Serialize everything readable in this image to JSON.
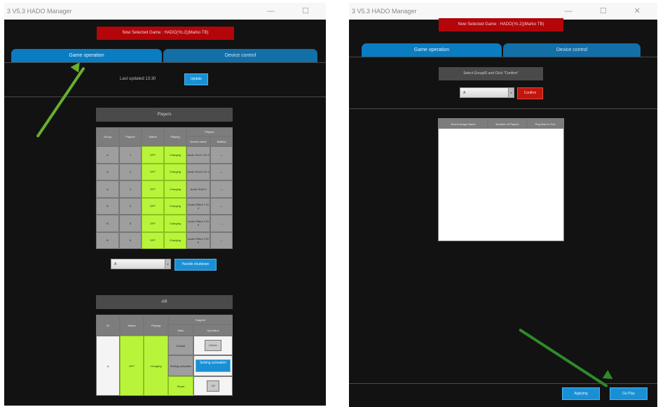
{
  "left_window": {
    "title": "3 V5.3 HADO Manager",
    "banner": "Now Selected Game : HADO(Yo.2)(Marko TB)",
    "tabs": [
      "Game operation",
      "Device control"
    ],
    "last_updated": "Last updated 13:30",
    "update_button": "Update",
    "players_title": "Players",
    "player_table": {
      "headers": [
        "Group",
        "Player#",
        "Status",
        "Playing",
        "Players"
      ],
      "sub_headers": [
        "Device name",
        "Battery"
      ],
      "rows": [
        [
          "A",
          "1",
          "OFF",
          "Charging",
          "Audio Shot 1 ID 2",
          "---"
        ],
        [
          "A",
          "2",
          "OFF",
          "Charging",
          "Audio Shot 2 ID 4",
          "---"
        ],
        [
          "A",
          "3",
          "OFF",
          "Charging",
          "Audio Shot 3",
          "---"
        ],
        [
          "B",
          "4",
          "OFF",
          "Charging",
          "Audio Effect 1 ID 4",
          "---"
        ],
        [
          "B",
          "5",
          "OFF",
          "Charging",
          "Audio Effect 2 ID 5",
          "---"
        ],
        [
          "B",
          "6",
          "OFF",
          "Charging",
          "Audio Effect 3 ID 6",
          "---"
        ]
      ]
    },
    "group_select": "A",
    "handle_button": "Handle shutdown",
    "ar_title": "AR",
    "ar_table": {
      "headers": [
        "ID",
        "Status",
        "Playing",
        "Support"
      ],
      "sub_headers": [
        "Main",
        "Operation"
      ],
      "id_value": "A",
      "status_value": "OFF",
      "playing_value": "Charging",
      "rows": [
        {
          "main": "Default",
          "operation": "Delete"
        },
        {
          "main": "Setting activation",
          "operation": "Setting activation"
        },
        {
          "main": "Reset",
          "operation": "Off"
        }
      ]
    }
  },
  "right_window": {
    "title": "3 V5.3 HADO Manager",
    "banner": "Now Selected Game : HADO(Yo.2)(Marko TB)",
    "tabs": [
      "Game operation",
      "Device control"
    ],
    "instruction": "Select GroupID and Click \"Confirm\"",
    "group_select": "A",
    "confirm_button": "Confirm",
    "table_headers": [
      "Sound image Name",
      "Number of Players",
      "Play time in Pos"
    ],
    "bottom_buttons": [
      "Applying",
      "Go Play"
    ]
  },
  "colors": {
    "background": "#121212",
    "banner": "#b3050a",
    "tab_active": "#0a7cc1",
    "highlight_green": "#b8f53a",
    "annotation_arrow": "#6aae2c"
  }
}
